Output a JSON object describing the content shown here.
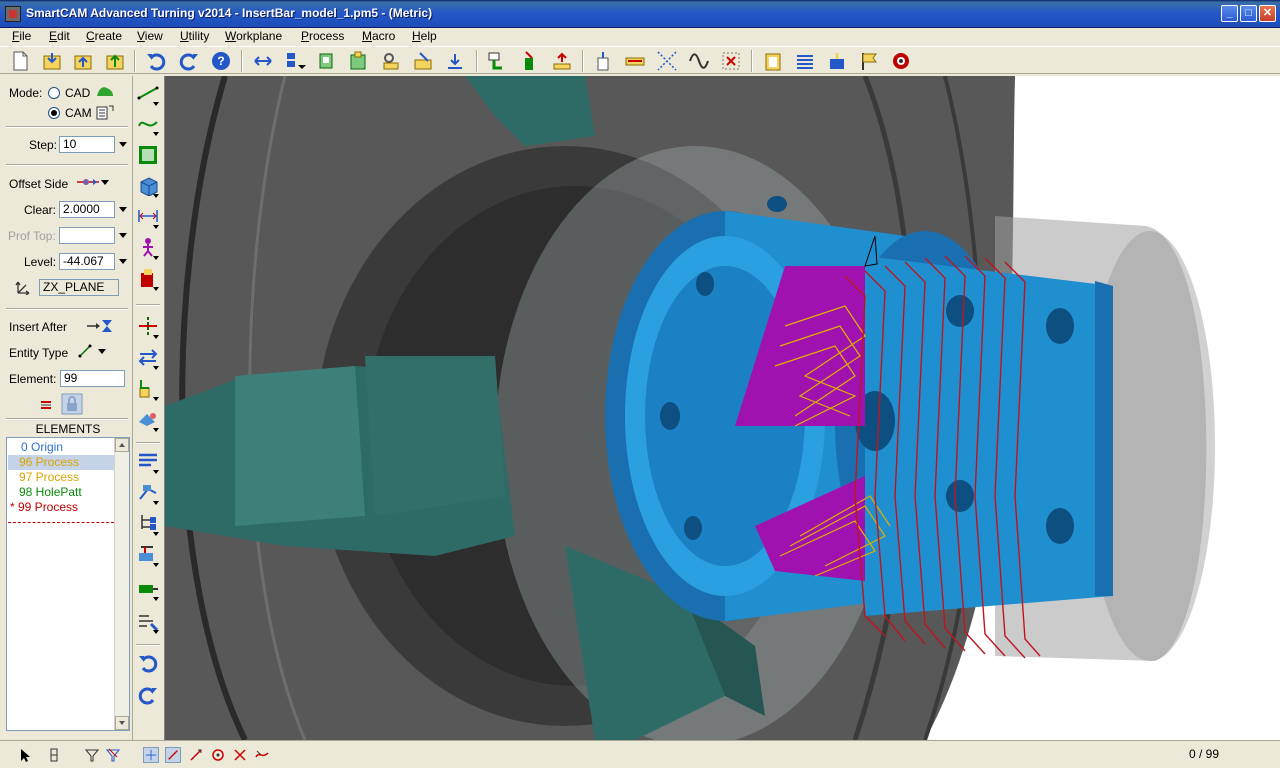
{
  "window": {
    "title": "SmartCAM Advanced Turning v2014 - InsertBar_model_1.pm5 - (Metric)",
    "minimize_glyph": "_",
    "maximize_glyph": "□",
    "close_glyph": "✕"
  },
  "menu": [
    "File",
    "Edit",
    "Create",
    "View",
    "Utility",
    "Workplane",
    "Process",
    "Macro",
    "Help"
  ],
  "panel": {
    "mode_label": "Mode:",
    "mode_cad": "CAD",
    "mode_cam": "CAM",
    "mode_selected": "CAM",
    "step_label": "Step:",
    "step_value": "10",
    "offset_side_label": "Offset Side",
    "clear_label": "Clear:",
    "clear_value": "2.0000",
    "prof_top_label": "Prof Top:",
    "prof_top_value": "",
    "level_label": "Level:",
    "level_value": "-44.067",
    "workplane_value": "ZX_PLANE",
    "insert_after_label": "Insert After",
    "entity_type_label": "Entity Type",
    "element_label": "Element:",
    "element_value": "99"
  },
  "elements": {
    "header": "ELEMENTS",
    "rows": [
      {
        "text": "0 Origin",
        "color": "#2f6fd6",
        "selected": false
      },
      {
        "text": "96 Process",
        "color": "#d9a400",
        "selected": true
      },
      {
        "text": "97 Process",
        "color": "#d9a400",
        "selected": false
      },
      {
        "text": "98 HolePatt",
        "color": "#0a8a0a",
        "selected": false
      },
      {
        "text": "* 99 Process",
        "color": "#c00000",
        "selected": false
      }
    ]
  },
  "status": {
    "count": "0 / 99"
  },
  "colors": {
    "part_blue": "#1f8fd0",
    "fixture_teal": "#2f6b66",
    "toolpath_red": "#c0141e",
    "toolpath_yellow": "#e0b000",
    "pocket_magenta": "#a012b0"
  },
  "icons": {
    "toolbar": [
      "new-file-icon",
      "open-file-icon",
      "open-folder-up-icon",
      "save-icon",
      "undo-icon",
      "redo-icon",
      "help-icon",
      "move-view-icon",
      "layout-icon",
      "copy-icon",
      "paste-icon",
      "edit-icon",
      "insert-icon",
      "align-icon",
      "select-icon",
      "chart-icon",
      "grid-icon",
      "measure-icon",
      "transform-icon",
      "wave-icon",
      "delete-icon",
      "clipboard-icon",
      "spring-icon",
      "tool-icon",
      "flag-icon",
      "settings-gear-icon"
    ],
    "vertical": [
      "line-icon",
      "curve-icon",
      "rectangle-icon",
      "cube-icon",
      "dimension-icon",
      "figure-icon",
      "stack-icon",
      "split-icon",
      "swap-icon",
      "move-icon",
      "fill-icon",
      "list-icon",
      "tool-path-icon",
      "tree-icon",
      "edit-tool-icon",
      "process-icon",
      "toolpath-icon",
      "undo-icon",
      "redo-icon"
    ]
  }
}
